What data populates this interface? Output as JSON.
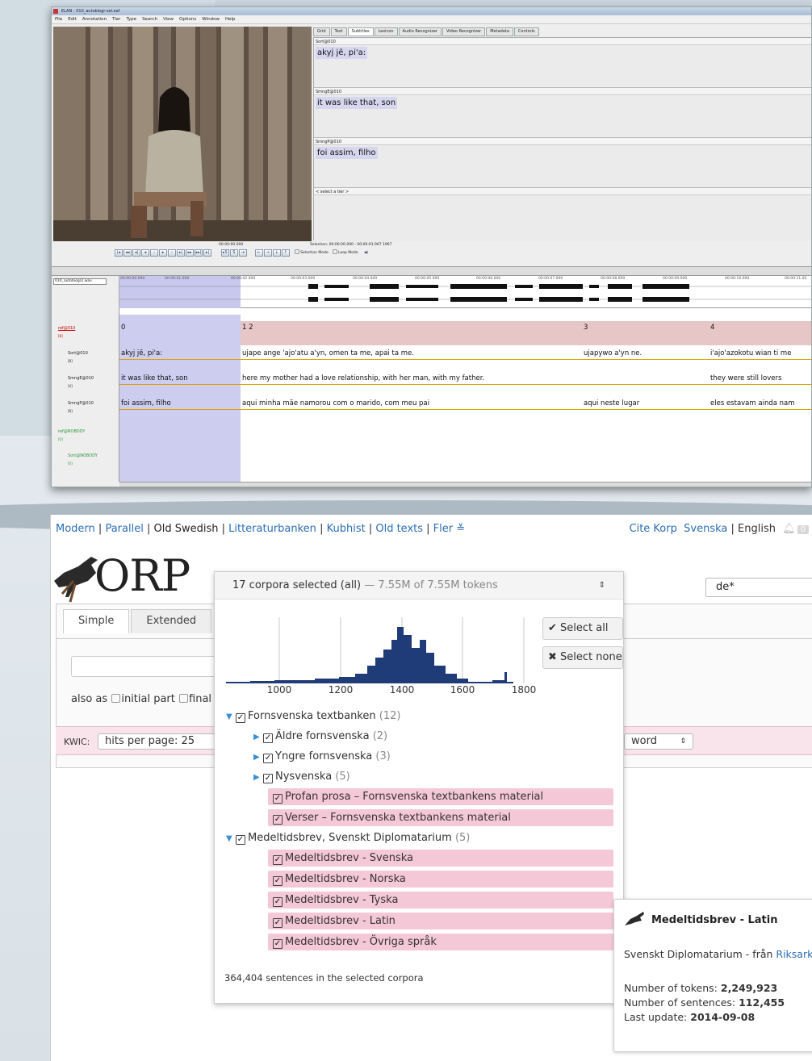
{
  "elan": {
    "title": "ELAN - 010_autobiogr-sel.eaf",
    "menu": [
      "File",
      "Edit",
      "Annotation",
      "Tier",
      "Type",
      "Search",
      "View",
      "Options",
      "Window",
      "Help"
    ],
    "tabs": [
      "Grid",
      "Text",
      "Subtitles",
      "Lexicon",
      "Audio Recognizer",
      "Video Recognizer",
      "Metadata",
      "Controls"
    ],
    "active_tab": "Subtitles",
    "subtitles": [
      {
        "tier": "Sort@010",
        "text": "akyj jẽ, pi'a:"
      },
      {
        "tier": "SmngE@010",
        "text": "it was like that, son"
      },
      {
        "tier": "SmngP@010",
        "text": "foi assim, filho"
      },
      {
        "tier": "< select a tier >",
        "text": ""
      }
    ],
    "media_time": "00:00:00.000",
    "selection": "Selection: 00:00:00.000 - 00:00:01.967  1967",
    "selection_mode": "Selection Mode",
    "loop_mode": "Loop Mode",
    "wave_file": "010_autobiogr2.wav",
    "ticks": [
      "00:00:00.000",
      "00:00:01.000",
      "00:00:02.000",
      "00:00:03.000",
      "00:00:04.000",
      "00:00:05.000",
      "00:00:06.000",
      "00:00:07.000",
      "00:00:08.000",
      "00:00:09.000",
      "00:00:10.000",
      "00:00:11.00"
    ],
    "tier_names": [
      "ref@010",
      "Sort@010",
      "SmngE@010",
      "SmngP@010",
      "ref@NOBODY",
      "Sort@NOBODY"
    ],
    "tier_counts": [
      "[8]",
      "[8]",
      "[4]",
      "[8]",
      "[0]",
      "[0]"
    ],
    "ref_labels": [
      "0",
      "1 2",
      "3",
      "4"
    ],
    "sort_row": [
      "akyj jẽ, pi'a:",
      "ujape ange 'ajo'atu a'yn, omen ta me, apai ta me.",
      "ujapywo a'yn ne.",
      "i'ajo'azokotu wian ti me"
    ],
    "engl_row": [
      "it was like that, son",
      "here  my mother had a love relationship, with her man, with my father.",
      "",
      "they were still lovers"
    ],
    "port_row": [
      "foi assim, filho",
      "aqui   minha mãe namorou com o marido, com meu pai",
      "aqui neste lugar",
      "eles estavam ainda nam"
    ]
  },
  "korp": {
    "nav": [
      "Modern",
      "Parallel",
      "Old Swedish",
      "Litteraturbanken",
      "Kubhist",
      "Old texts",
      "Fler ≚"
    ],
    "nav_active": "Old Swedish",
    "cite": "Cite Korp",
    "lang_sv": "Svenska",
    "lang_en": "English",
    "notif_count": "0",
    "logo_text": "ORP",
    "search_value": "de*",
    "tabs": [
      "Simple",
      "Extended"
    ],
    "also_as": "also as",
    "initial_part": "initial part",
    "final": "final",
    "kwic_label": "KWIC:",
    "hits_per_page": "hits per page: 25",
    "sort_select": "word",
    "corpus_summary": "17 corpora selected (all)",
    "corpus_tokens": " — 7.55M of 7.55M tokens",
    "select_all": "Select all",
    "select_none": "Select none",
    "hist_axis": [
      "1000",
      "1200",
      "1400",
      "1600",
      "1800"
    ],
    "tree": [
      {
        "label": "Fornsvenska textbanken",
        "count": "(12)",
        "level": 0,
        "folder": true,
        "open": true,
        "pink": false
      },
      {
        "label": "Äldre fornsvenska",
        "count": "(2)",
        "level": 1,
        "folder": true,
        "open": false,
        "pink": false
      },
      {
        "label": "Yngre fornsvenska",
        "count": "(3)",
        "level": 1,
        "folder": true,
        "open": false,
        "pink": false
      },
      {
        "label": "Nysvenska",
        "count": "(5)",
        "level": 1,
        "folder": true,
        "open": false,
        "pink": false
      },
      {
        "label": "Profan prosa – Fornsvenska textbankens material",
        "count": "",
        "level": 1,
        "folder": false,
        "pink": true
      },
      {
        "label": "Verser – Fornsvenska textbankens material",
        "count": "",
        "level": 1,
        "folder": false,
        "pink": true
      },
      {
        "label": "Medeltidsbrev, Svenskt Diplomatarium",
        "count": "(5)",
        "level": 0,
        "folder": true,
        "open": true,
        "pink": false
      },
      {
        "label": "Medeltidsbrev - Svenska",
        "count": "",
        "level": 1,
        "folder": false,
        "pink": true
      },
      {
        "label": "Medeltidsbrev - Norska",
        "count": "",
        "level": 1,
        "folder": false,
        "pink": true
      },
      {
        "label": "Medeltidsbrev - Tyska",
        "count": "",
        "level": 1,
        "folder": false,
        "pink": true
      },
      {
        "label": "Medeltidsbrev - Latin",
        "count": "",
        "level": 1,
        "folder": false,
        "pink": true
      },
      {
        "label": "Medeltidsbrev - Övriga språk",
        "count": "",
        "level": 1,
        "folder": false,
        "pink": true
      }
    ],
    "sentences": "364,404 sentences in the selected corpora",
    "info": {
      "title": "Medeltidsbrev - Latin",
      "source_prefix": "Svenskt Diplomatarium - från ",
      "source_link": "Riksarkiv",
      "tokens_label": "Number of tokens: ",
      "tokens": "2,249,923",
      "sentences_label": "Number of sentences: ",
      "sentences": "112,455",
      "updated_label": "Last update: ",
      "updated": "2014-09-08"
    }
  }
}
